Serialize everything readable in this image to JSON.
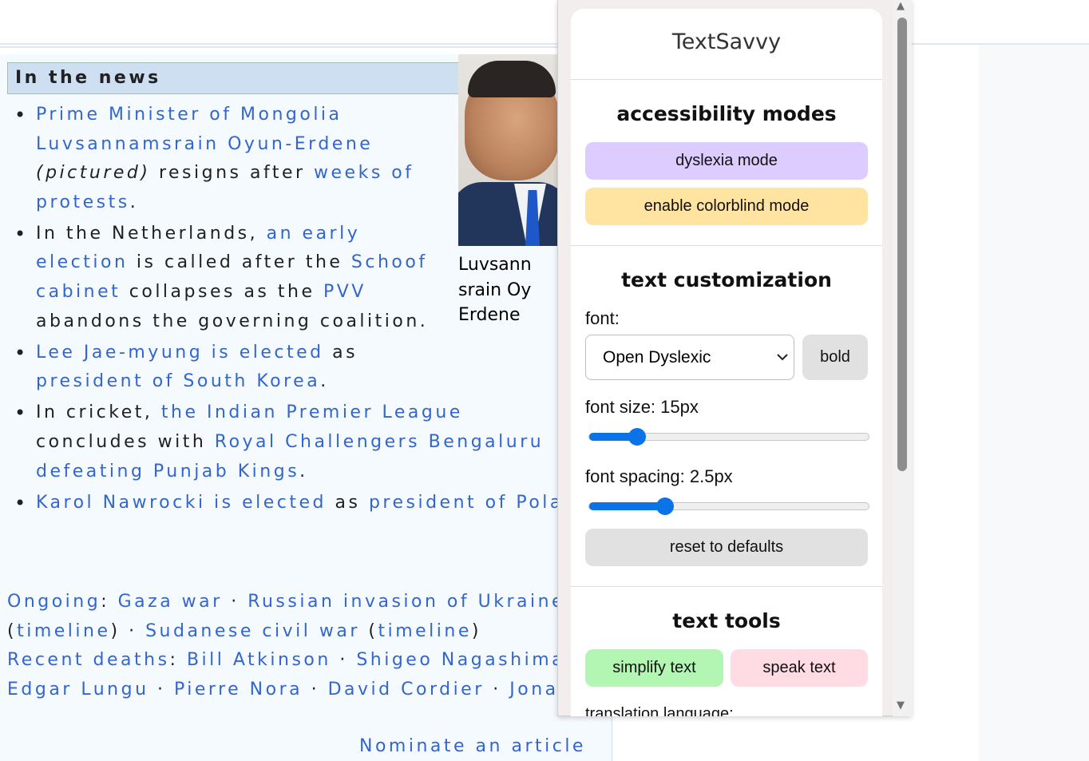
{
  "news": {
    "heading": "In the news",
    "items": [
      {
        "a1": "Prime Minister of Mongolia Luvsannamsrain Oyun-Erdene",
        "a2": "(pictured)",
        "a3": " resigns after ",
        "a4": "weeks of protests",
        "a5": "."
      },
      {
        "b1": "In the Netherlands, ",
        "b2": "an early election",
        "b3": " is called after the ",
        "b4": "Schoof cabinet",
        "b5": " collapses as the ",
        "b6": "PVV",
        "b7": " abandons the governing coalition."
      },
      {
        "c1": "Lee Jae-myung is elected",
        "c2": " as ",
        "c3": "president of South Korea",
        "c4": "."
      },
      {
        "d1": "In cricket, ",
        "d2": "the Indian Premier League",
        "d3": " concludes with ",
        "d4": "Royal Challengers Bengaluru",
        "d5": " ",
        "d6": "defeating",
        "d7": " ",
        "d8": "Punjab Kings",
        "d9": "."
      },
      {
        "e1": "Karol Nawrocki is elected",
        "e2": " as ",
        "e3": "president of Poland",
        "e4": "."
      }
    ],
    "caption_lines": [
      "Luvsann",
      "srain Oy",
      "Erdene"
    ],
    "ongoing_label": "Ongoing",
    "ongoing_colon": ": ",
    "ongoing_items": [
      "Gaza war",
      "Russian invasion of Ukraine"
    ],
    "ongoing_row2": {
      "p1": "(",
      "t1": "timeline",
      "p2": ") · ",
      "s": "Sudanese civil war",
      "p3": " (",
      "t2": "timeline",
      "p4": ")"
    },
    "recent_label": "Recent deaths",
    "recent_colon": ": ",
    "recent_items": [
      "Bill Atkinson",
      "Shigeo Nagashima",
      "Edgar Lungu",
      "Pierre Nora",
      "David Cordier",
      "Jonathan Joss"
    ],
    "separator": " · ",
    "nominate": "Nominate an article"
  },
  "popup": {
    "title": "TextSavvy",
    "accessibility": {
      "heading": "accessibility modes",
      "dyslexia_label": "dyslexia mode",
      "colorblind_label": "enable colorblind mode"
    },
    "text_custom": {
      "heading": "text customization",
      "font_label": "font:",
      "font_value": "Open Dyslexic",
      "bold_label": "bold",
      "font_size_label": "font size: 15px",
      "font_size_fraction": 0.17,
      "spacing_label": "font spacing: 2.5px",
      "spacing_fraction": 0.27,
      "reset_label": "reset to defaults"
    },
    "tools": {
      "heading": "text tools",
      "simplify_label": "simplify text",
      "speak_label": "speak text",
      "translation_label": "translation language:"
    }
  },
  "colors": {
    "link": "#3366cc",
    "dyslexia_btn": "#dcccff",
    "colorblind_btn": "#ffe3a0",
    "neutral_btn": "#e1e1e1",
    "simplify_btn": "#b3f5b3",
    "speak_btn": "#ffdce4",
    "slider": "#0a73e8"
  }
}
